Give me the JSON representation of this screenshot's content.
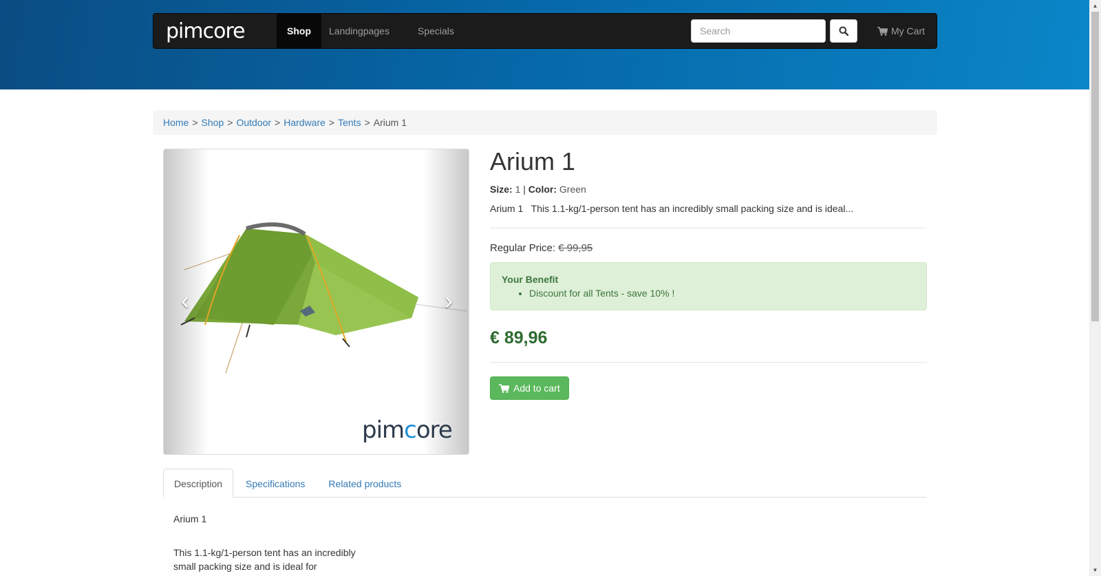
{
  "header": {
    "brand": "pimcore",
    "nav": [
      {
        "label": "Shop",
        "active": true
      },
      {
        "label": "Landingpages",
        "active": false
      },
      {
        "label": "Specials",
        "active": false
      }
    ],
    "search_placeholder": "Search",
    "cart_label": "My Cart"
  },
  "breadcrumb": {
    "items": [
      "Home",
      "Shop",
      "Outdoor",
      "Hardware",
      "Tents"
    ],
    "current": "Arium 1"
  },
  "gallery": {
    "watermark_a": "pim",
    "watermark_c": "c",
    "watermark_b": "ore",
    "prev_icon": "chevron-left-icon",
    "next_icon": "chevron-right-icon"
  },
  "product": {
    "title": "Arium 1",
    "size_label": "Size:",
    "size_value": "1",
    "color_label": "Color:",
    "color_value": "Green",
    "short_description": "Arium 1   This 1.1-kg/1-person tent has an incredibly small packing size and is ideal...",
    "regular_price_label": "Regular Price:",
    "regular_price": "€ 99,95",
    "benefit_title": "Your Benefit",
    "benefit_item": "Discount for all Tents - save 10% !",
    "price": "€ 89,96",
    "add_to_cart": "Add to cart"
  },
  "tabs": [
    {
      "label": "Description",
      "active": true
    },
    {
      "label": "Specifications",
      "active": false
    },
    {
      "label": "Related products",
      "active": false
    }
  ],
  "description": {
    "line1": "Arium 1",
    "line2": "This 1.1-kg/1-person tent has an incredibly small packing size and is ideal for"
  },
  "colors": {
    "hero": "#0666a6",
    "navbar": "#1b1b1b",
    "link": "#337ab7",
    "success_btn": "#5cb85c",
    "price": "#2e6b30",
    "benefit_bg": "#dff0d8"
  }
}
